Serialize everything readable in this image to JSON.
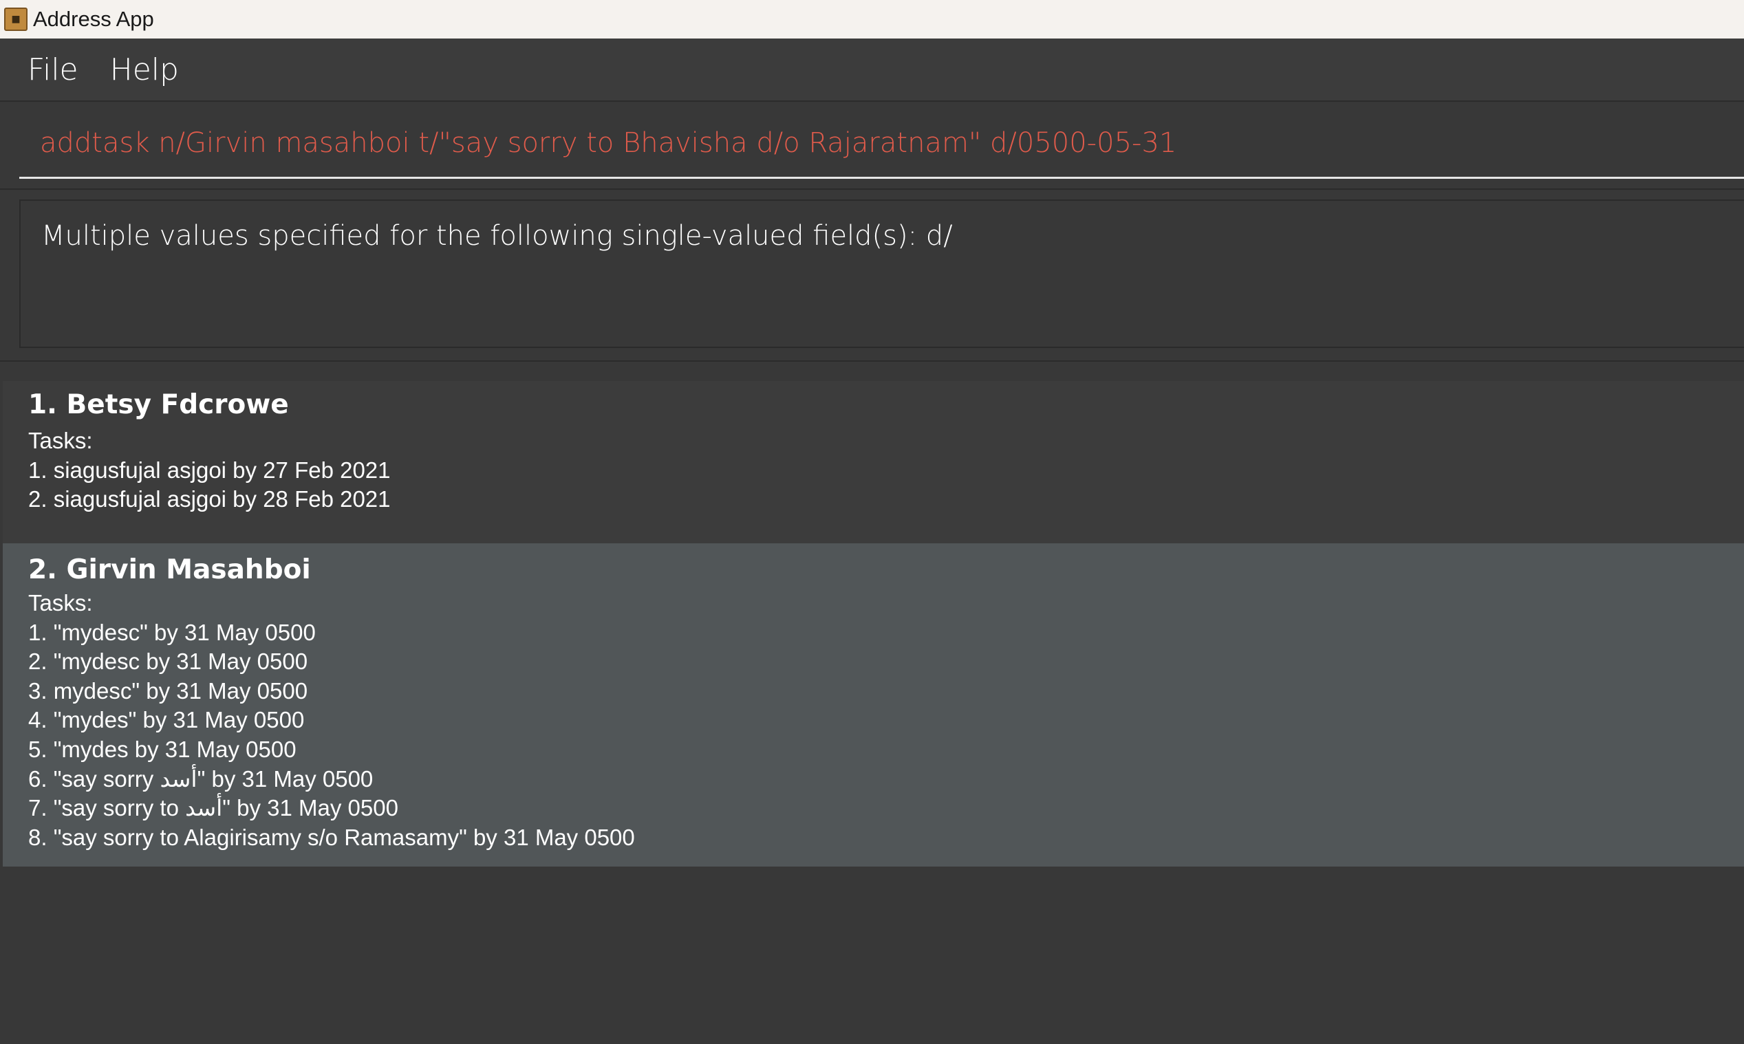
{
  "window": {
    "title": "Address App",
    "icon": "address-book-icon"
  },
  "menu": {
    "items": [
      "File",
      "Help"
    ]
  },
  "command": {
    "text": "addtask n/Girvin masahboi t/\"say sorry to Bhavisha d/o Rajaratnam\" d/0500-05-31"
  },
  "result": {
    "text": "Multiple values specified for the following single-valued field(s): d/"
  },
  "persons": [
    {
      "name": "1. Betsy Fdcrowe",
      "tasks_label": "Tasks:",
      "tasks": [
        "1. siagusfujal asjgoi by 27 Feb 2021",
        "2. siagusfujal asjgoi by 28 Feb 2021"
      ]
    },
    {
      "name": "2. Girvin Masahboi",
      "tasks_label": "Tasks:",
      "tasks": [
        "1. \"mydesc\" by 31 May 0500",
        "2. \"mydesc by 31 May 0500",
        "3. mydesc\" by 31 May 0500",
        "4. \"mydes\" by 31 May 0500",
        "5. \"mydes by 31 May 0500",
        "6. \"say sorry أسد\" by 31 May 0500",
        "7. \"say sorry to أسد\" by 31 May 0500",
        "8. \"say sorry to Alagirisamy s/o Ramasamy\" by 31 May 0500"
      ]
    }
  ],
  "colors": {
    "background": "#383838",
    "command_text": "#e05b4b",
    "selected_card": "#515658"
  }
}
